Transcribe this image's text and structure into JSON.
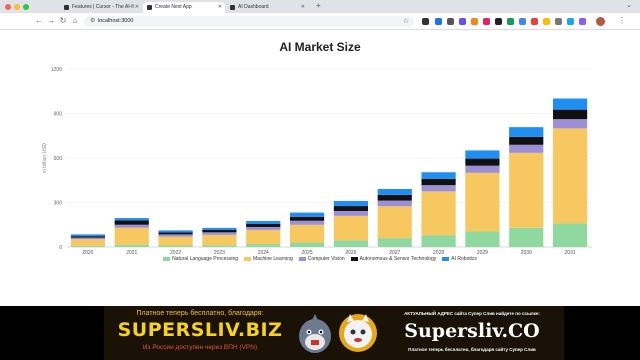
{
  "browser": {
    "tabs": [
      {
        "title": "Features | Cursor - The AI-fi",
        "active": false
      },
      {
        "title": "Create Next App",
        "active": true
      },
      {
        "title": "AI Dashboard",
        "active": false
      }
    ],
    "url": "localhost:3000",
    "traffic_colors": [
      "#ff5f57",
      "#febc2e",
      "#28c840"
    ],
    "icons": [
      "back-icon",
      "forward-icon",
      "reload-icon",
      "home-icon",
      "star-icon",
      "new-tab-icon",
      "menu-icon"
    ]
  },
  "chart_data": {
    "type": "bar",
    "stacked": true,
    "title": "AI Market Size",
    "xlabel": "",
    "ylabel": "in billion USD",
    "ylim": [
      0,
      1200
    ],
    "yticks": [
      0,
      300,
      600,
      900,
      1200
    ],
    "grid": true,
    "legend_position": "bottom",
    "categories": [
      "2020",
      "2021",
      "2022",
      "2023",
      "2024",
      "2025",
      "2026",
      "2027",
      "2028",
      "2029",
      "2030",
      "2031"
    ],
    "series": [
      {
        "name": "Natural Language Processing",
        "color": "#8fd8a0",
        "values": [
          8,
          15,
          10,
          12,
          20,
          30,
          45,
          60,
          80,
          105,
          130,
          160
        ]
      },
      {
        "name": "Machine Learning",
        "color": "#f7c85f",
        "values": [
          45,
          115,
          60,
          70,
          95,
          120,
          165,
          215,
          295,
          395,
          505,
          640
        ]
      },
      {
        "name": "Computer Vision",
        "color": "#9c8fd6",
        "values": [
          10,
          20,
          15,
          17,
          20,
          27,
          33,
          38,
          42,
          48,
          54,
          62
        ]
      },
      {
        "name": "Autonomous & Sensor Technology",
        "color": "#111111",
        "values": [
          10,
          30,
          14,
          16,
          20,
          27,
          33,
          38,
          43,
          48,
          54,
          64
        ]
      },
      {
        "name": "AI Robotics",
        "color": "#1f8ef1",
        "values": [
          12,
          15,
          13,
          14,
          20,
          28,
          34,
          40,
          44,
          55,
          65,
          75
        ]
      }
    ]
  },
  "banner": {
    "line1": "Платное теперь бесплатно, благодаря:",
    "brand1": "SUPERSLIV.BIZ",
    "line2": "Из России доступен через ВПН (VPN)",
    "line3": "АКТУАЛЬНЫЙ АДРЕС сайта Супер Слив найдете по ссылке:",
    "brand2": "Supersliv.CO",
    "line4": "Платное теперь бесплатно, благодаря сайту Супер Слив",
    "colors": {
      "background": "#1a1207",
      "yellow": "#f6d21a",
      "orange": "#e8562a"
    }
  }
}
